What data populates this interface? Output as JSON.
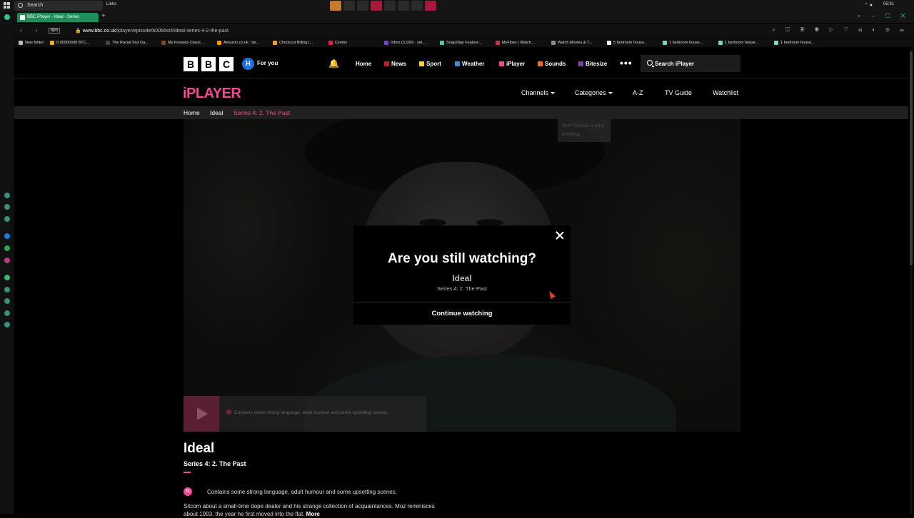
{
  "taskbar": {
    "search_label": "Search",
    "links_label": "Links",
    "clock": "05:31"
  },
  "browser": {
    "tab_title": "BBC iPlayer - Ideal - Series",
    "vpn_label": "VPN",
    "url_host": "www.bbc.co.uk",
    "url_path": "/iplayer/episode/b00b6st4/ideal-series-4-2-the-past",
    "bookmarks": [
      "New folder",
      "0.00000000 BTC...",
      "The Racial Slur Da...",
      "My Freeads Classi...",
      "Amazon.co.uk : de...",
      "Checkout Billing |...",
      "Cineby",
      "Inbox (3,190) - yel...",
      "Soap2day Feature...",
      "MyFlixer | Watch...",
      "Watch Movies & T...",
      "5 bedroom house...",
      "1 bedroom house...",
      "1 bedroom house...",
      "1 bedroom house..."
    ]
  },
  "bbc_header": {
    "logo_letters": [
      "B",
      "B",
      "C"
    ],
    "account_initial": "H",
    "for_you": "For you",
    "nav": [
      "Home",
      "News",
      "Sport",
      "Weather",
      "iPlayer",
      "Sounds",
      "Bitesize"
    ],
    "more": "•••",
    "search_placeholder": "Search iPlayer"
  },
  "iplayer_bar": {
    "logo": "iPLAYER",
    "channels": "Channels",
    "categories": "Categories",
    "az": "A-Z",
    "tv_guide": "TV Guide",
    "watchlist": "Watchlist"
  },
  "breadcrumb": {
    "home": "Home",
    "show": "Ideal",
    "current": "Series 4: 2. The Past"
  },
  "player": {
    "smpte_line1": "SMPTimecan 1.43.8",
    "smpte_line2": "600dBsg",
    "guidance_overlay": "Contains some strong language, adult humour and some upsetting scenes."
  },
  "modal": {
    "title": "Are you still watching?",
    "show": "Ideal",
    "episode": "Series 4: 2. The Past",
    "continue": "Continue watching"
  },
  "episode": {
    "title": "Ideal",
    "subtitle": "Series 4: 2. The Past",
    "guidance_badge": "G",
    "guidance": "Contains some strong language, adult humour and some upsetting scenes.",
    "synopsis": "Sitcom about a small-time dope dealer and his strange collection of acquaintances. Moz reminisces about 1993, the year he first moved into the flat.",
    "more": "More"
  },
  "colors": {
    "iplayer_pink": "#f54997",
    "tab_green": "#1f8f5a",
    "account_blue": "#1d70e0"
  }
}
